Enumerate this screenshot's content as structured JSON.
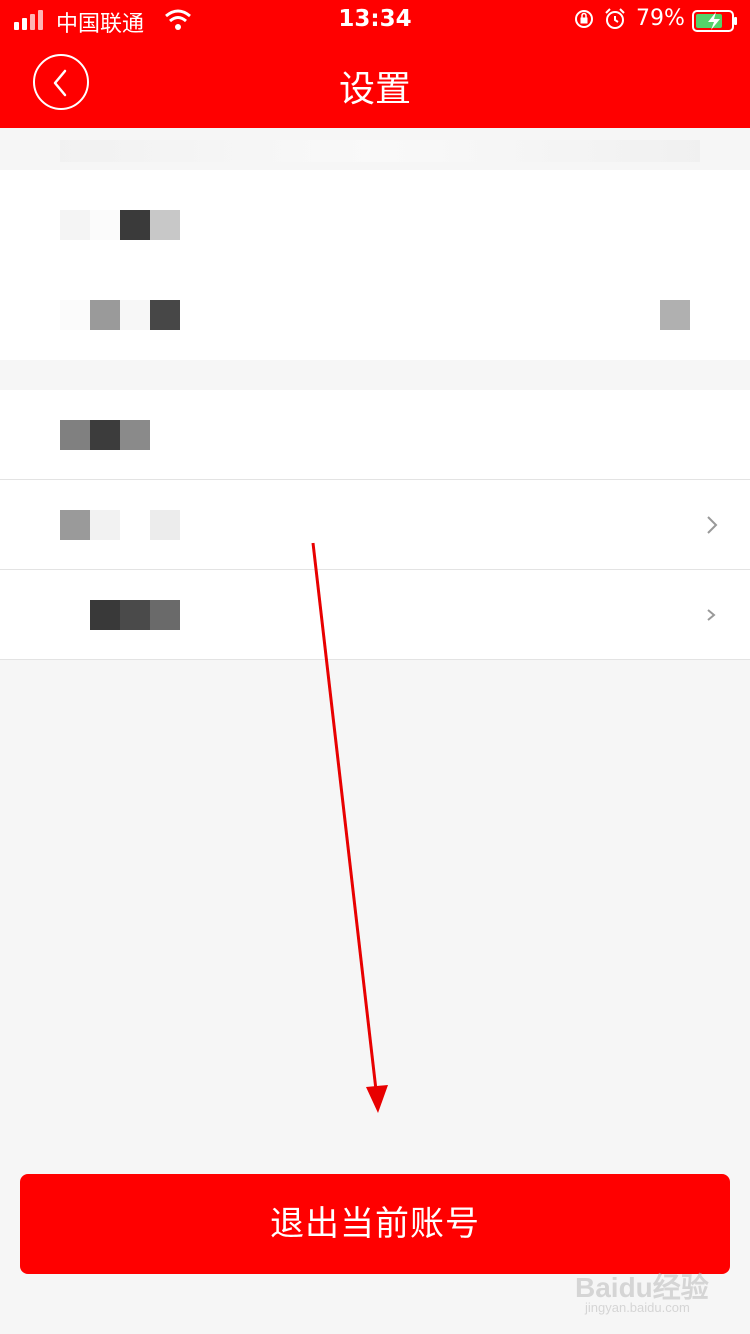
{
  "status_bar": {
    "carrier": "中国联通",
    "time": "13:34",
    "battery_percent": "79%"
  },
  "header": {
    "title": "设置",
    "back_icon": "chevron-left-icon",
    "background_color": "#ff0000"
  },
  "settings_rows": [
    {
      "label": "obscured",
      "has_chevron": false
    },
    {
      "label": "obscured",
      "has_chevron": false
    },
    {
      "label": "obscured",
      "has_chevron": false
    },
    {
      "label": "obscured",
      "has_chevron": true
    },
    {
      "label": "obscured",
      "has_chevron": true
    }
  ],
  "annotation": {
    "arrow_color": "#e80000"
  },
  "logout_button": {
    "label": "退出当前账号",
    "color": "#ff0000"
  },
  "watermark": {
    "text": "Baidu经验",
    "subtext": "jingyan.baidu.com"
  }
}
